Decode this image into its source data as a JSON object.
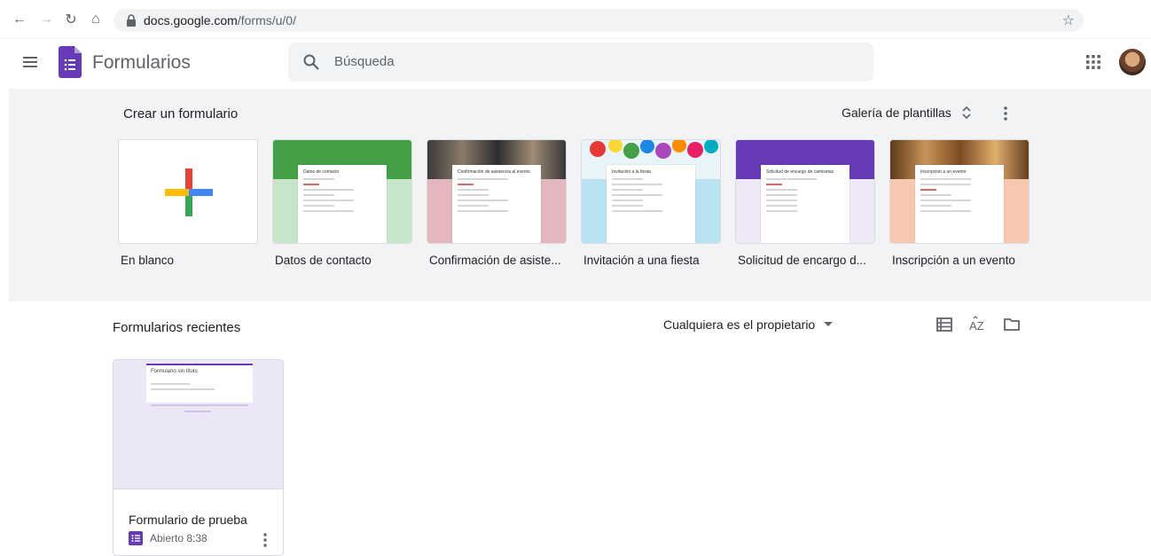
{
  "browser": {
    "url_host": "docs.google.com",
    "url_path": "/forms/u/0/"
  },
  "header": {
    "app_title": "Formularios",
    "search_placeholder": "Búsqueda"
  },
  "gallery": {
    "title": "Crear un formulario",
    "gallery_button": "Galería de plantillas",
    "templates": [
      {
        "label": "En blanco"
      },
      {
        "label": "Datos de contacto",
        "preview_title": "Datos de contacto"
      },
      {
        "label": "Confirmación de asiste...",
        "preview_title": "Confirmación de asistencia al evento"
      },
      {
        "label": "Invitación a una fiesta",
        "preview_title": "Invitación a la fiesta"
      },
      {
        "label": "Solicitud de encargo d...",
        "preview_title": "Solicitud de encargo de camisetas"
      },
      {
        "label": "Inscripción a un evento",
        "preview_title": "Inscripción a un evento"
      }
    ]
  },
  "recent": {
    "title": "Formularios recientes",
    "owner_filter": "Cualquiera es el propietario",
    "forms": [
      {
        "name": "Formulario de prueba",
        "meta": "Abierto 8:38",
        "preview_title": "Formulario sin título"
      }
    ]
  },
  "colors": {
    "forms_purple": "#673ab7",
    "band_bg": "#f1f3f4",
    "contact_green": "#43a047",
    "event_pink": "#e2b7bd",
    "party_blue": "#b9e3f3",
    "shirt_purple": "#673ab7",
    "register_peach": "#f7c8b0"
  }
}
